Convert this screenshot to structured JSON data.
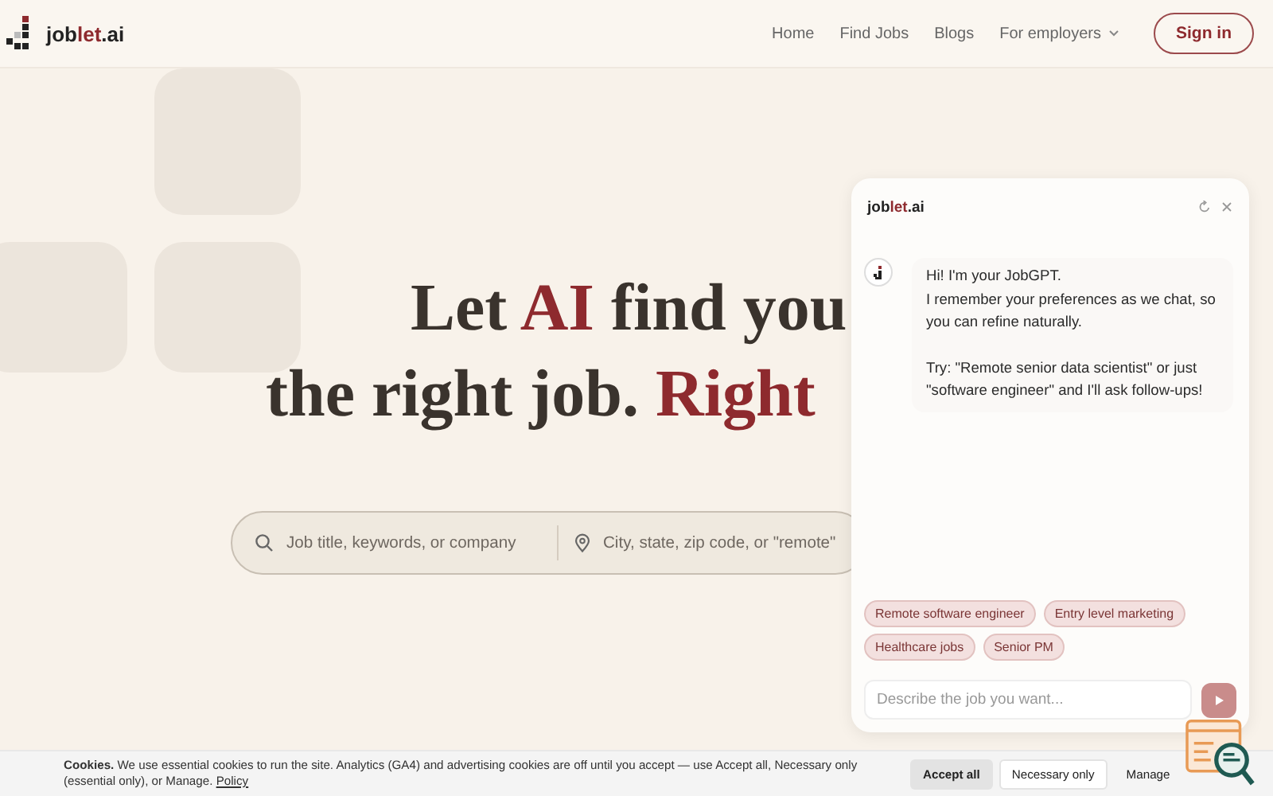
{
  "header": {
    "logo": [
      {
        "text": "job",
        "accent": false
      },
      {
        "text": "let",
        "accent": true
      },
      {
        "text": ".ai",
        "accent": false
      }
    ],
    "nav": [
      {
        "label": "Home",
        "dropdown": false
      },
      {
        "label": "Find Jobs",
        "dropdown": false
      },
      {
        "label": "Blogs",
        "dropdown": false
      },
      {
        "label": "For employers",
        "dropdown": true
      }
    ],
    "sign_in": "Sign in"
  },
  "hero": {
    "headline": [
      [
        {
          "text": "Let ",
          "accent": false
        },
        {
          "text": "AI",
          "accent": true
        },
        {
          "text": " find you",
          "accent": false
        }
      ],
      [
        {
          "text": "the right job. ",
          "accent": false
        },
        {
          "text": "Right",
          "accent": true
        }
      ]
    ],
    "search": {
      "keyword_placeholder": "Job title, keywords, or company",
      "location_placeholder": "City, state, zip code, or \"remote\""
    }
  },
  "chat": {
    "title": [
      {
        "text": "job",
        "accent": false
      },
      {
        "text": "let",
        "accent": true
      },
      {
        "text": ".ai",
        "accent": false
      }
    ],
    "message": [
      "Hi! I'm your JobGPT.\nI remember your preferences as we chat, so you can refine naturally.",
      "Try: \"Remote senior data scientist\" or just \"software engineer\" and I'll ask follow-ups!"
    ],
    "suggestions": [
      "Remote software engineer",
      "Entry level marketing",
      "Healthcare jobs",
      "Senior PM"
    ],
    "input_placeholder": "Describe the job you want..."
  },
  "cookie_bar": {
    "text": "**Cookies.** We use essential cookies to run the site. Analytics (GA4) and advertising cookies are off until you accept — use Accept all, Necessary only (essential only), or Manage.",
    "policy_link": "Policy",
    "buttons": [
      {
        "label": "Accept all",
        "kind": "primary"
      },
      {
        "label": "Necessary only",
        "kind": "secondary"
      },
      {
        "label": "Manage",
        "kind": "link"
      }
    ]
  }
}
